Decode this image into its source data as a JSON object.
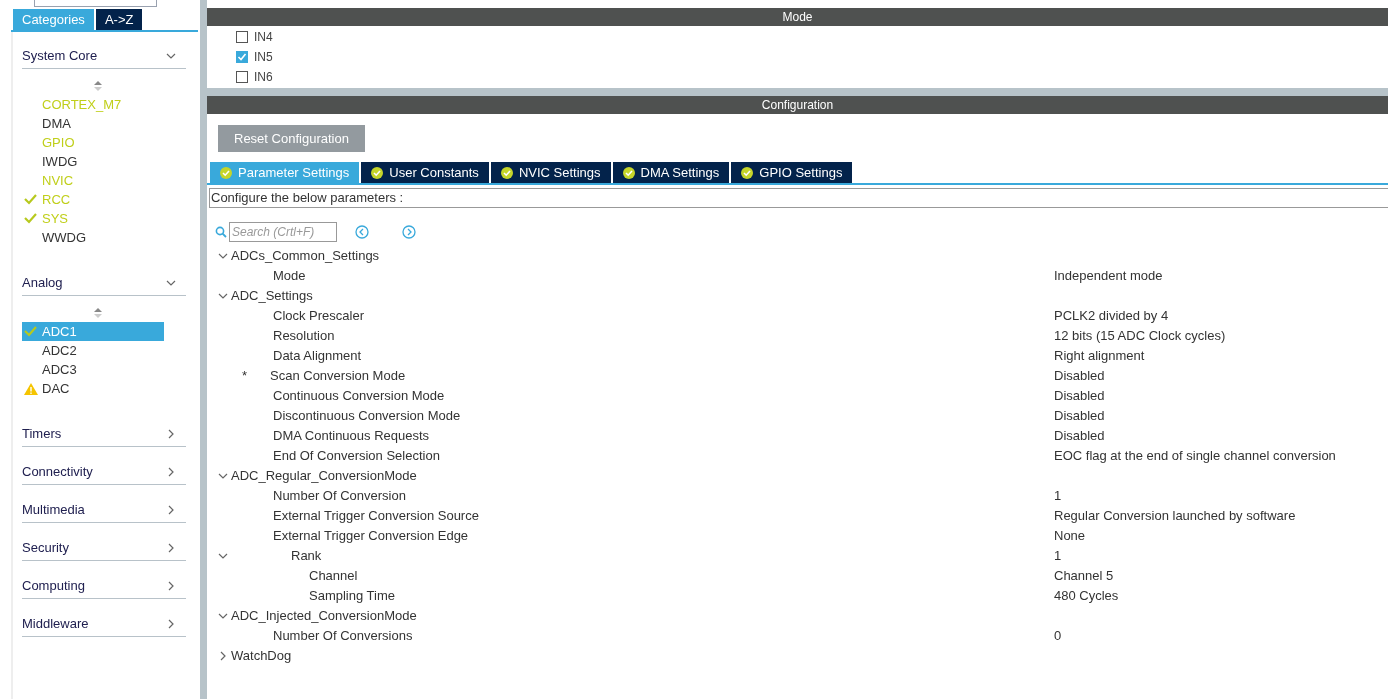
{
  "sidebar": {
    "tabs": [
      {
        "label": "Categories",
        "selected": true
      },
      {
        "label": "A->Z",
        "selected": false
      }
    ],
    "categories": [
      {
        "name": "System Core",
        "expanded": true,
        "items": [
          {
            "label": "CORTEX_M7",
            "configured": true,
            "checked": false,
            "warning": false,
            "selected": false
          },
          {
            "label": "DMA",
            "configured": false,
            "checked": false,
            "warning": false,
            "selected": false
          },
          {
            "label": "GPIO",
            "configured": true,
            "checked": false,
            "warning": false,
            "selected": false
          },
          {
            "label": "IWDG",
            "configured": false,
            "checked": false,
            "warning": false,
            "selected": false
          },
          {
            "label": "NVIC",
            "configured": true,
            "checked": false,
            "warning": false,
            "selected": false
          },
          {
            "label": "RCC",
            "configured": true,
            "checked": true,
            "warning": false,
            "selected": false
          },
          {
            "label": "SYS",
            "configured": true,
            "checked": true,
            "warning": false,
            "selected": false
          },
          {
            "label": "WWDG",
            "configured": false,
            "checked": false,
            "warning": false,
            "selected": false
          }
        ]
      },
      {
        "name": "Analog",
        "expanded": true,
        "items": [
          {
            "label": "ADC1",
            "configured": false,
            "checked": true,
            "warning": false,
            "selected": true
          },
          {
            "label": "ADC2",
            "configured": false,
            "checked": false,
            "warning": false,
            "selected": false
          },
          {
            "label": "ADC3",
            "configured": false,
            "checked": false,
            "warning": false,
            "selected": false
          },
          {
            "label": "DAC",
            "configured": false,
            "checked": false,
            "warning": true,
            "selected": false
          }
        ]
      },
      {
        "name": "Timers",
        "expanded": false
      },
      {
        "name": "Connectivity",
        "expanded": false
      },
      {
        "name": "Multimedia",
        "expanded": false
      },
      {
        "name": "Security",
        "expanded": false
      },
      {
        "name": "Computing",
        "expanded": false
      },
      {
        "name": "Middleware",
        "expanded": false
      }
    ]
  },
  "mode": {
    "title": "Mode",
    "channels": [
      {
        "label": "IN4",
        "checked": false
      },
      {
        "label": "IN5",
        "checked": true
      },
      {
        "label": "IN6",
        "checked": false
      }
    ]
  },
  "configuration": {
    "title": "Configuration",
    "reset_button": "Reset Configuration",
    "tabs": [
      {
        "label": "Parameter Settings",
        "selected": true
      },
      {
        "label": "User Constants",
        "selected": false
      },
      {
        "label": "NVIC Settings",
        "selected": false
      },
      {
        "label": "DMA Settings",
        "selected": false
      },
      {
        "label": "GPIO Settings",
        "selected": false
      }
    ],
    "hint": "Configure the below parameters :",
    "search": {
      "placeholder": "Search (Crtl+F)"
    },
    "tree": [
      {
        "label": "ADCs_Common_Settings",
        "expanded": true,
        "children": [
          {
            "label": "Mode",
            "value": "Independent mode"
          }
        ]
      },
      {
        "label": "ADC_Settings",
        "expanded": true,
        "children": [
          {
            "label": "Clock Prescaler",
            "value": "PCLK2 divided by 4"
          },
          {
            "label": "Resolution",
            "value": "12 bits (15 ADC Clock cycles)"
          },
          {
            "label": "Data Alignment",
            "value": "Right alignment"
          },
          {
            "label": "Scan Conversion Mode",
            "value": "Disabled",
            "marker": "*"
          },
          {
            "label": "Continuous Conversion Mode",
            "value": "Disabled"
          },
          {
            "label": "Discontinuous Conversion Mode",
            "value": "Disabled"
          },
          {
            "label": "DMA Continuous Requests",
            "value": "Disabled"
          },
          {
            "label": "End Of Conversion Selection",
            "value": "EOC flag at the end of single channel conversion"
          }
        ]
      },
      {
        "label": "ADC_Regular_ConversionMode",
        "expanded": true,
        "children": [
          {
            "label": "Number Of Conversion",
            "value": "1"
          },
          {
            "label": "External Trigger Conversion Source",
            "value": "Regular Conversion launched by software"
          },
          {
            "label": "External Trigger Conversion Edge",
            "value": "None"
          },
          {
            "label": "Rank",
            "value": "1",
            "expanded": true,
            "children": [
              {
                "label": "Channel",
                "value": "Channel 5"
              },
              {
                "label": "Sampling Time",
                "value": "480 Cycles"
              }
            ]
          }
        ]
      },
      {
        "label": "ADC_Injected_ConversionMode",
        "expanded": true,
        "children": [
          {
            "label": "Number Of Conversions",
            "value": "0"
          }
        ]
      },
      {
        "label": "WatchDog",
        "expanded": false
      }
    ]
  }
}
